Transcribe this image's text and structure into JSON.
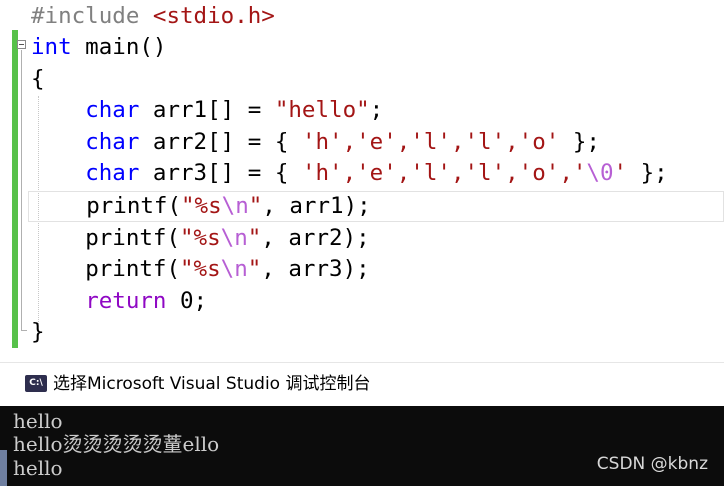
{
  "editor": {
    "lines": [
      {
        "a": "#include ",
        "b": "<stdio.h>"
      },
      {
        "a": "int",
        "b": " main()"
      },
      {
        "a": "{"
      },
      {
        "kw": "char",
        "rest": " arr1[] = ",
        "str": "\"hello\"",
        "end": ";"
      },
      {
        "kw": "char",
        "rest": " arr2[] = { ",
        "chars": "'h','e','l','l','o'",
        "end": " };"
      },
      {
        "kw": "char",
        "rest": " arr3[] = { ",
        "chars": "'h','e','l','l','o','",
        "esc": "\\0",
        "chars2": "'",
        "end": " };"
      },
      {
        "fn": "printf(",
        "s1": "\"%s",
        "esc": "\\n",
        "s2": "\"",
        "end": ", arr1);"
      },
      {
        "fn": "printf(",
        "s1": "\"%s",
        "esc": "\\n",
        "s2": "\"",
        "end": ", arr2);"
      },
      {
        "fn": "printf(",
        "s1": "\"%s",
        "esc": "\\n",
        "s2": "\"",
        "end": ", arr3);"
      },
      {
        "kw": "return",
        "end": " 0;"
      },
      {
        "a": "}"
      }
    ]
  },
  "console": {
    "title": "选择Microsoft Visual Studio 调试控制台",
    "icon_text": "C:\\",
    "icon": "console-window-icon",
    "output": [
      "hello",
      "hello烫烫烫烫烫蕫ello",
      "hello"
    ]
  },
  "watermark": "CSDN @kbnz",
  "colors": {
    "keyword": "#0000ff",
    "return_keyword": "#8f08c4",
    "string": "#a31515",
    "escape": "#b75fd4",
    "change_bar": "#57c14a",
    "console_bg": "#0c0c0c"
  }
}
